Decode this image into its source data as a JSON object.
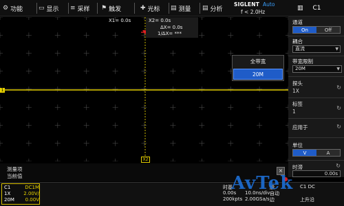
{
  "menu": [
    {
      "icon": "gear-icon",
      "glyph": "⚙",
      "label": "功能"
    },
    {
      "icon": "monitor-icon",
      "glyph": "▭",
      "label": "显示"
    },
    {
      "icon": "acquire-icon",
      "glyph": "≡",
      "label": "采样"
    },
    {
      "icon": "flag-icon",
      "glyph": "⚑",
      "label": "触发"
    },
    {
      "icon": "cursor-icon",
      "glyph": "✚",
      "label": "光标"
    },
    {
      "icon": "measure-icon",
      "glyph": "▤",
      "label": "测量"
    },
    {
      "icon": "analysis-icon",
      "glyph": "▤",
      "label": "分析"
    }
  ],
  "brand": {
    "name": "SIGLENT",
    "trigger_mode": "Auto",
    "frequency": "f < 2.0Hz"
  },
  "channel_title": {
    "glyph": "▥",
    "label": "C1"
  },
  "cursors": {
    "x1": "X1= 0.0s",
    "x2": "X2= 0.0s",
    "delta_x": "ΔX= 0.0s",
    "inv_delta_x": "1/ΔX= ***",
    "x2_marker": "X2",
    "ch1_marker": "1"
  },
  "bandwidth_menu": {
    "options": [
      "全带宽",
      "20M"
    ],
    "selected": "20M"
  },
  "panel": {
    "channel_label": "通道",
    "channel_on": "On",
    "channel_off": "Off",
    "coupling_label": "耦合",
    "coupling_value": "直流",
    "bw_label": "带宽限制",
    "bw_value": "20M",
    "probe_label": "探头",
    "probe_value": "1X",
    "tag_label": "标签",
    "tag_value": "1",
    "apply_label": "应用于",
    "unit_label": "单位",
    "unit_v": "V",
    "unit_a": "A",
    "delay_label": "时滞",
    "delay_value": "0.00s"
  },
  "measure": {
    "label1": "测量项",
    "label2": "当前值",
    "close": "×"
  },
  "bottom": {
    "ch1": {
      "name": "C1",
      "coupling": "DC1M",
      "probe": "1X",
      "scale": "2.00V/",
      "bw": "20M",
      "offset": "0.00V"
    },
    "timebase": {
      "label": "时基",
      "delay": "0.00s",
      "scale": "10.0ns/div",
      "memory": "200kpts",
      "sample_rate": "2.00GSa/s"
    },
    "trigger": {
      "label": "触",
      "mode": "自动",
      "edge": "边"
    },
    "trigger2": {
      "source": "C1 DC",
      "level": "上升沿"
    }
  },
  "watermark": "AvTek"
}
